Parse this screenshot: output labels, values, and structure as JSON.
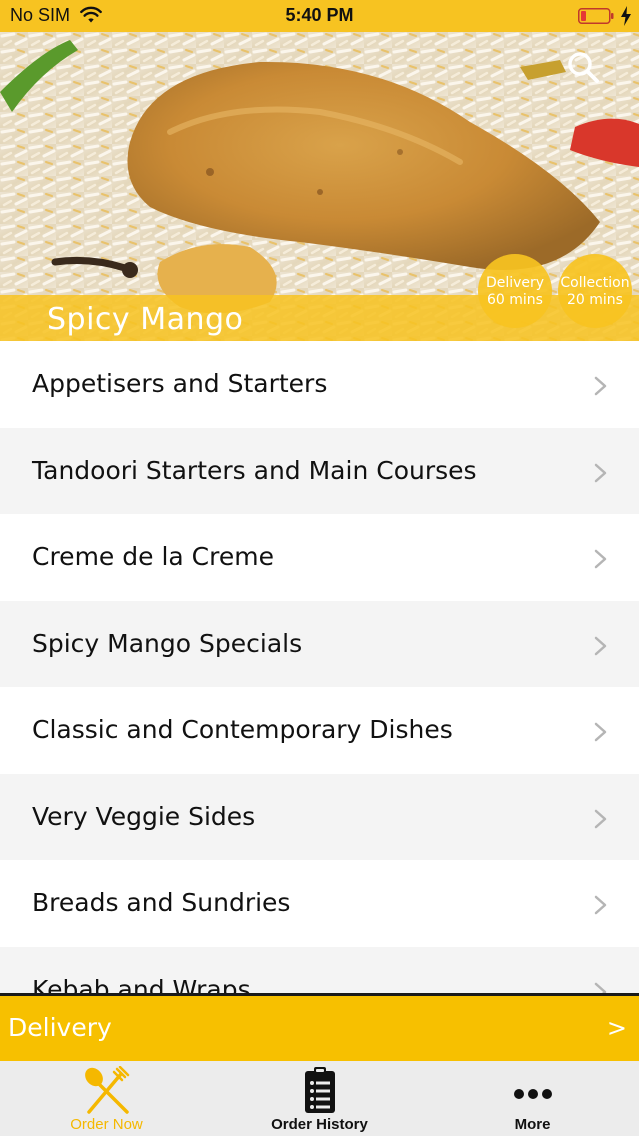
{
  "status_bar": {
    "carrier": "No SIM",
    "time": "5:40 PM",
    "icons": [
      "wifi-icon",
      "battery-icon",
      "charging-icon"
    ]
  },
  "hero": {
    "restaurant_name": "Spicy Mango",
    "search_icon": "search-icon",
    "badges": {
      "delivery": {
        "label": "Delivery",
        "time": "60 mins"
      },
      "collection": {
        "label": "Collection",
        "time": "20 mins"
      }
    }
  },
  "menu": {
    "items": [
      {
        "label": "Appetisers and Starters"
      },
      {
        "label": "Tandoori Starters and Main Courses"
      },
      {
        "label": "Creme de la Creme"
      },
      {
        "label": "Spicy Mango Specials"
      },
      {
        "label": "Classic and Contemporary Dishes"
      },
      {
        "label": "Very Veggie Sides"
      },
      {
        "label": "Breads and Sundries"
      },
      {
        "label": "Kebab and Wraps"
      }
    ]
  },
  "delivery_bar": {
    "label": "Delivery",
    "arrow": ">"
  },
  "tab_bar": {
    "tabs": [
      {
        "label": "Order Now",
        "icon": "fork-knife-icon",
        "active": true
      },
      {
        "label": "Order History",
        "icon": "clipboard-icon",
        "active": false
      },
      {
        "label": "More",
        "icon": "ellipsis-icon",
        "active": false
      }
    ]
  },
  "colors": {
    "brand_yellow": "#f7c321",
    "delivery_bar": "#f7c000",
    "active_tab": "#f5b800",
    "list_alt_row": "#f4f4f4",
    "text_dark": "#111111"
  }
}
